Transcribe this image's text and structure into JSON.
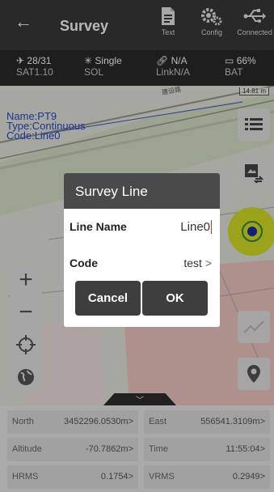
{
  "header": {
    "back_glyph": "←",
    "title": "Survey",
    "buttons": [
      {
        "icon": "document-icon",
        "label": "Text"
      },
      {
        "icon": "gear-icon",
        "label": "Config"
      },
      {
        "icon": "usb-icon",
        "label": "Connected"
      }
    ]
  },
  "status": {
    "sat": {
      "top": "28/31",
      "bottom": "SAT1.10"
    },
    "sol": {
      "top": "Single",
      "bottom": "SOL"
    },
    "link": {
      "top": "N/A",
      "bottom": "LinkN/A"
    },
    "bat": {
      "top": "66%",
      "bottom": "BAT"
    }
  },
  "map": {
    "point_info": [
      "Name:PT9",
      "Type:Continuous",
      "Code:Line0"
    ],
    "scale_label": "14.81 m",
    "road_label": "建设路"
  },
  "dialog": {
    "title": "Survey Line",
    "line_name_label": "Line Name",
    "line_name_value": "Line0",
    "code_label": "Code",
    "code_value": "test",
    "code_chevron": ">",
    "cancel_label": "Cancel",
    "ok_label": "OK"
  },
  "coords": {
    "north": {
      "label": "North",
      "value": "3452296.0530m"
    },
    "east": {
      "label": "East",
      "value": "556541.3109m"
    },
    "altitude": {
      "label": "Altitude",
      "value": "-70.7862m"
    },
    "time": {
      "label": "Time",
      "value": "11:55:04"
    },
    "hrms": {
      "label": "HRMS",
      "value": "0.1754"
    },
    "vrms": {
      "label": "VRMS",
      "value": "0.2949"
    },
    "chevron": ">"
  },
  "colors": {
    "header": "#3a3a3a",
    "status_bar": "#2a2a2a",
    "map_text": "#2b48c9",
    "gps_ring": "#d6e224",
    "gps_dot": "#1a2fa8"
  }
}
